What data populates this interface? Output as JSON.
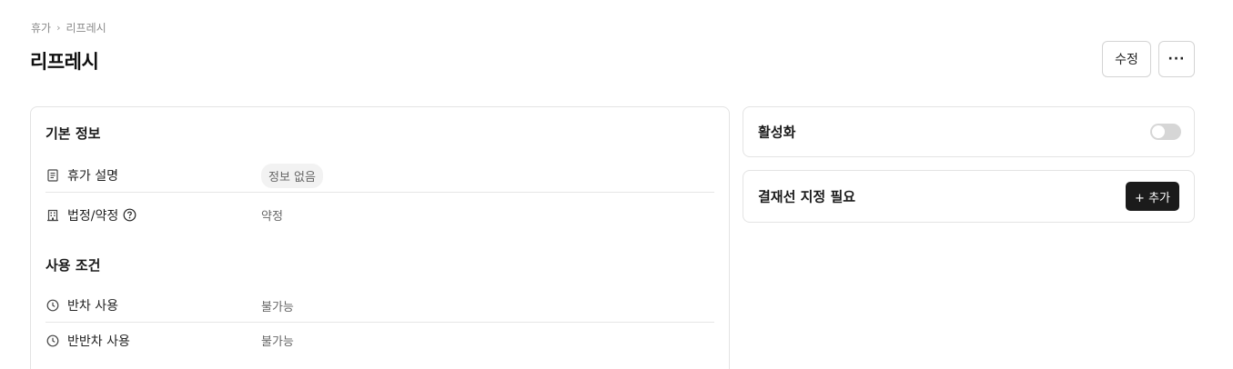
{
  "breadcrumb": {
    "parent": "휴가",
    "separator": "›",
    "current": "리프레시"
  },
  "page": {
    "title": "리프레시"
  },
  "actions": {
    "edit_label": "수정",
    "more_label": "···"
  },
  "basic_info": {
    "title": "기본 정보",
    "rows": [
      {
        "label": "휴가 설명",
        "icon": "document-icon",
        "value": "정보 없음"
      },
      {
        "label": "법정/약정",
        "icon": "building-icon",
        "help_icon": "question-icon",
        "value": "약정"
      }
    ]
  },
  "usage_conditions": {
    "title": "사용 조건",
    "rows": [
      {
        "label": "반차 사용",
        "icon": "clock-icon",
        "value": "불가능"
      },
      {
        "label": "반반차 사용",
        "icon": "clock-icon",
        "value": "불가능"
      }
    ]
  },
  "activation": {
    "title": "활성화",
    "enabled": false
  },
  "approval": {
    "title": "결재선 지정 필요",
    "add_label": "+ 추가"
  }
}
